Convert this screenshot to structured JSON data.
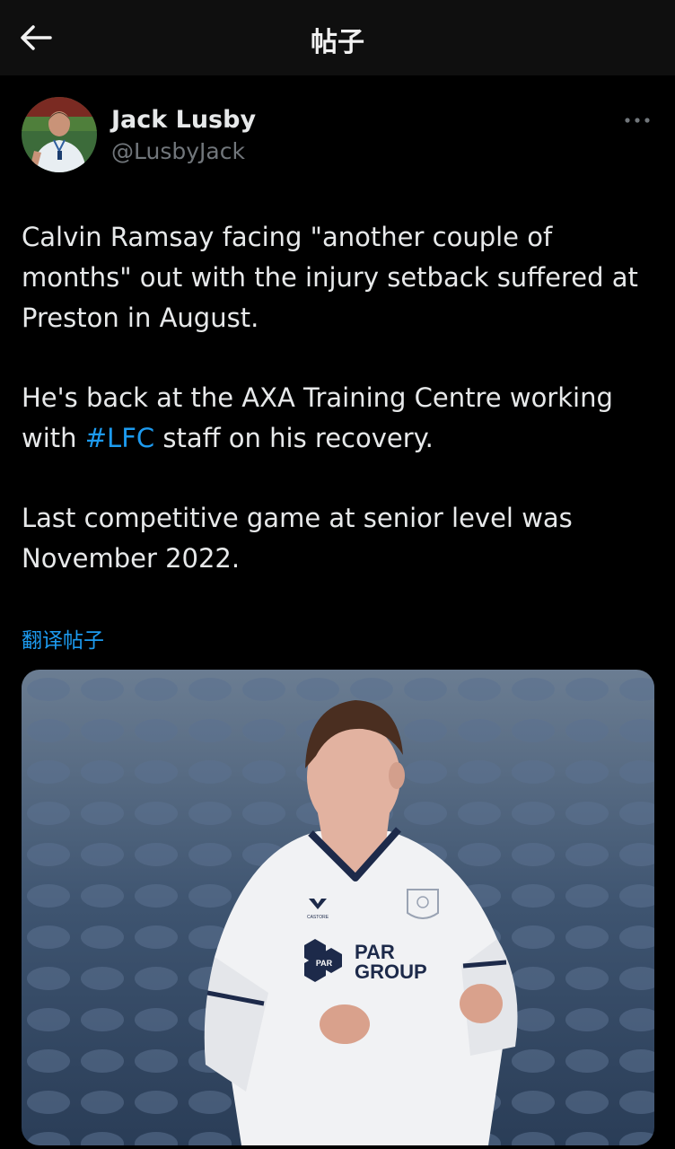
{
  "header": {
    "title": "帖子",
    "back_icon": "arrow-left-icon"
  },
  "author": {
    "name": "Jack Lusby",
    "handle": "@LusbyJack",
    "more_icon": "more-horizontal-icon"
  },
  "tweet": {
    "para1": "Calvin Ramsay facing \"another couple of\nmonths\" out with the injury setback suffered at\nPreston in August.",
    "para2_before": "He's back at the AXA Training Centre working\nwith ",
    "para2_hashtag": "#LFC",
    "para2_after": " staff on his recovery.",
    "para3": "Last competitive game at senior level was\nNovember 2022.",
    "translate_label": "翻译帖子"
  },
  "media": {
    "sponsor_line1": "PAR",
    "sponsor_line2": "GROUP",
    "sponsor_badge": "PAR",
    "kit_brand": "CASTORE"
  },
  "colors": {
    "background": "#000000",
    "accent": "#1d9bf0",
    "text": "#e7e9ea",
    "muted": "#71767b"
  }
}
